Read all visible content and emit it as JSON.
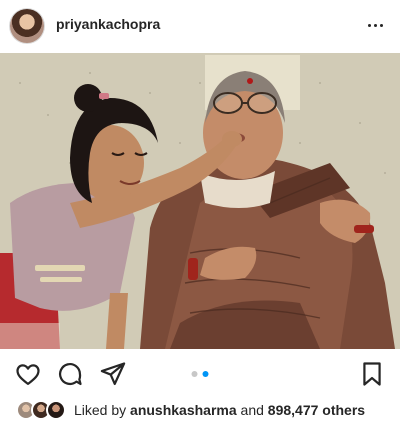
{
  "post": {
    "username": "priyankachopra",
    "image_alt": "Girl feeding her grandmother a snack"
  },
  "carousel": {
    "count": 2,
    "active_index": 1
  },
  "likes": {
    "prefix": "Liked by",
    "liker": "anushkasharma",
    "and": "and",
    "count": "898,477 others"
  },
  "icons": [
    "more-options-icon",
    "heart-icon",
    "comment-icon",
    "share-icon",
    "bookmark-icon"
  ],
  "colors": {
    "accent": "#0095f6",
    "text": "#262626",
    "dot_inactive": "#c7c7c7"
  }
}
